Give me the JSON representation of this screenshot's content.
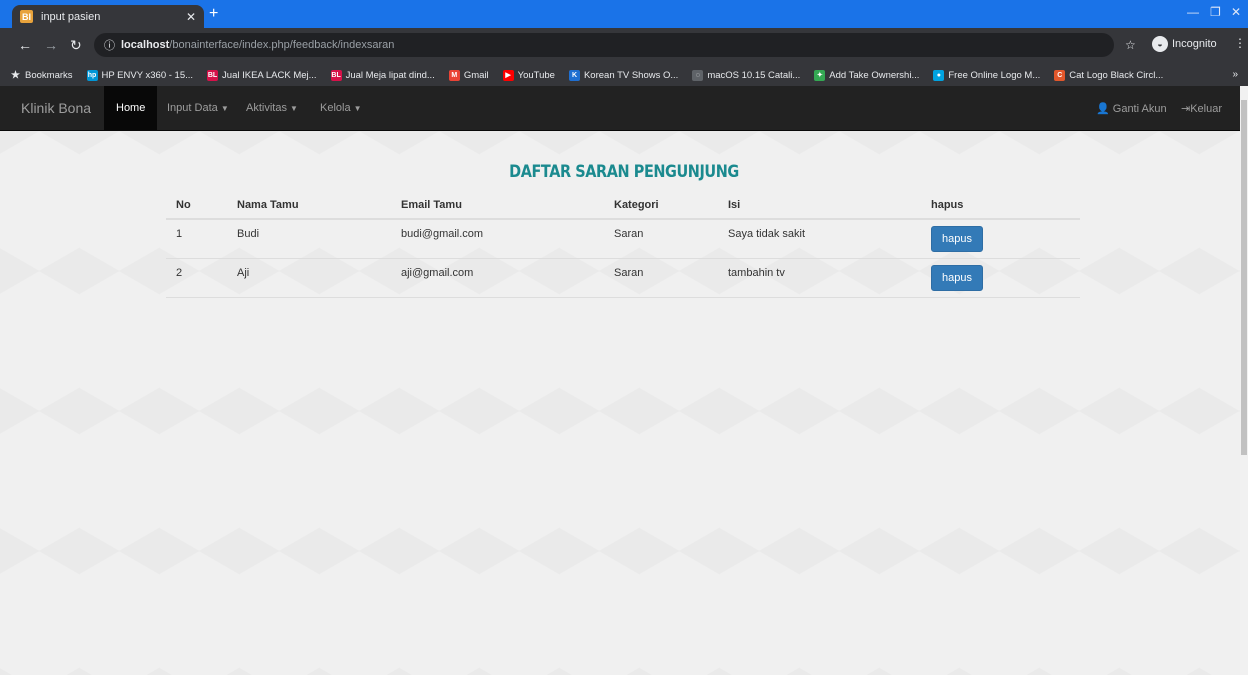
{
  "browser": {
    "tab_title": "input pasien",
    "tab_favicon": "BI",
    "new_tab": "+",
    "url_host": "localhost",
    "url_path": "/bonainterface/index.php/feedback/indexsaran",
    "incognito_label": "Incognito",
    "bookmarks": [
      {
        "label": "Bookmarks",
        "icon": "star-icon",
        "color": "#e8eaed",
        "glyph": "★"
      },
      {
        "label": "HP ENVY x360 - 15...",
        "icon": "hp-icon",
        "color": "#0096d6",
        "glyph": "hp"
      },
      {
        "label": "Jual IKEA LACK Mej...",
        "icon": "bl-icon",
        "color": "#d71149",
        "glyph": "BL"
      },
      {
        "label": "Jual Meja lipat dind...",
        "icon": "bl-icon",
        "color": "#d71149",
        "glyph": "BL"
      },
      {
        "label": "Gmail",
        "icon": "gmail-icon",
        "color": "#ea4335",
        "glyph": "M"
      },
      {
        "label": "YouTube",
        "icon": "youtube-icon",
        "color": "#ff0000",
        "glyph": "▶"
      },
      {
        "label": "Korean TV Shows O...",
        "icon": "k-icon",
        "color": "#1f6fd1",
        "glyph": "K"
      },
      {
        "label": "macOS 10.15 Catali...",
        "icon": "globe-icon",
        "color": "#5f6368",
        "glyph": "◌"
      },
      {
        "label": "Add Take Ownershi...",
        "icon": "puzzle-icon",
        "color": "#34a853",
        "glyph": "✦"
      },
      {
        "label": "Free Online Logo M...",
        "icon": "logo-maker-icon",
        "color": "#00a3e0",
        "glyph": "●"
      },
      {
        "label": "Cat Logo Black Circl...",
        "icon": "cat-logo-icon",
        "color": "#e2572b",
        "glyph": "C"
      }
    ]
  },
  "nav": {
    "brand": "Klinik Bona",
    "home": "Home",
    "input_data": "Input Data",
    "aktivitas": "Aktivitas",
    "kelola": "Kelola",
    "ganti_akun": "Ganti Akun",
    "keluar": "Keluar"
  },
  "main": {
    "title": "DAFTAR SARAN PENGUNJUNG",
    "columns": [
      "No",
      "Nama Tamu",
      "Email Tamu",
      "Kategori",
      "Isi",
      "hapus"
    ],
    "rows": [
      {
        "no": "1",
        "nama": "Budi",
        "email": "budi@gmail.com",
        "kategori": "Saran",
        "isi": "Saya tidak sakit",
        "action": "hapus"
      },
      {
        "no": "2",
        "nama": "Aji",
        "email": "aji@gmail.com",
        "kategori": "Saran",
        "isi": "tambahin tv",
        "action": "hapus"
      }
    ]
  }
}
